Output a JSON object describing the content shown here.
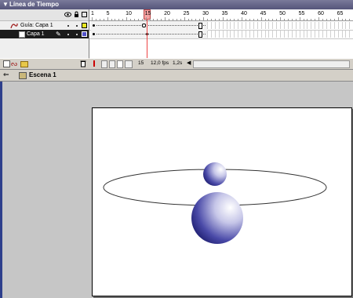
{
  "panel": {
    "title": "Línea de Tiempo",
    "collapse_icon": "triangle-down-icon"
  },
  "layers": [
    {
      "name": "Guía: Capa 1",
      "type": "guide",
      "selected": false,
      "outline_color": "#e8e820"
    },
    {
      "name": "Capa 1",
      "type": "normal",
      "selected": true,
      "outline_color": "#5050c8"
    }
  ],
  "ruler": {
    "labels": [
      "1",
      "5",
      "10",
      "15",
      "20",
      "25",
      "30",
      "35",
      "40",
      "45",
      "50",
      "55",
      "60",
      "65"
    ]
  },
  "status": {
    "current_frame": "15",
    "frame_rate": "12,0 fps",
    "elapsed_time": "1,2s"
  },
  "scene": {
    "label": "Escena 1"
  },
  "colors": {
    "title_bar": "#55557a",
    "stage": "#ffffff",
    "playhead": "#e44444",
    "sphere": "#2a2a8a"
  }
}
